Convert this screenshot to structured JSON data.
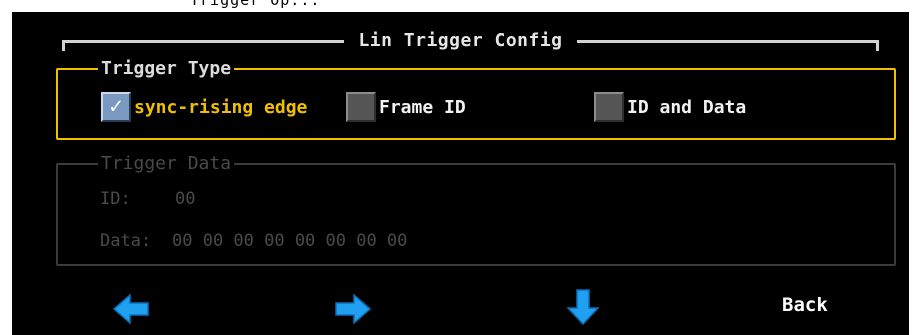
{
  "window": {
    "title_fragment": "Trigger Op..."
  },
  "dialog": {
    "title": "Lin Trigger Config"
  },
  "trigger_type": {
    "legend": "Trigger Type",
    "options": [
      {
        "label": "sync-rising edge",
        "checked": true
      },
      {
        "label": "Frame ID",
        "checked": false
      },
      {
        "label": "ID and Data",
        "checked": false
      }
    ]
  },
  "trigger_data": {
    "legend": "Trigger Data",
    "id_label": "ID:",
    "id_value": "00",
    "data_label": "Data:",
    "data_value": "00 00 00 00 00 00 00 00"
  },
  "nav": {
    "left_icon": "arrow-left-icon",
    "right_icon": "arrow-right-icon",
    "down_icon": "arrow-down-icon",
    "back_label": "Back"
  },
  "colors": {
    "accent": "#f0c000",
    "arrow": "#1fa0f0",
    "background": "#000000",
    "disabled": "#4a4a4a"
  }
}
